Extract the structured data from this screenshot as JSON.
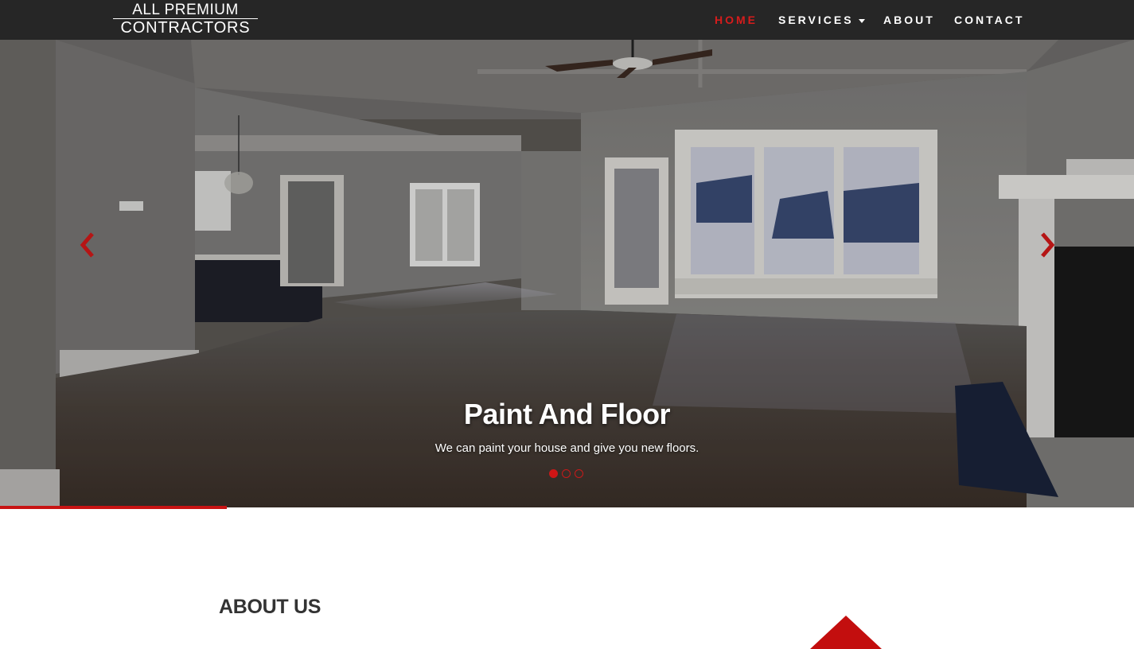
{
  "logo": {
    "line1": "ALL PREMIUM",
    "line2": "CONTRACTORS"
  },
  "nav": {
    "items": [
      {
        "label": "HOME",
        "active": true
      },
      {
        "label": "SERVICES",
        "active": false,
        "dropdown": true
      },
      {
        "label": "ABOUT",
        "active": false
      },
      {
        "label": "CONTACT",
        "active": false
      }
    ]
  },
  "carousel": {
    "caption_title": "Paint And Floor",
    "caption_text": "We can paint your house and give you new floors.",
    "slides_count": 3,
    "active_slide": 1,
    "progress": 0.2,
    "prev_icon": "chevron-left-icon",
    "next_icon": "chevron-right-icon"
  },
  "about": {
    "title": "ABOUT US"
  },
  "colors": {
    "navbar_bg": "#262626",
    "accent": "#d61c1c",
    "text_dark": "#333333"
  }
}
